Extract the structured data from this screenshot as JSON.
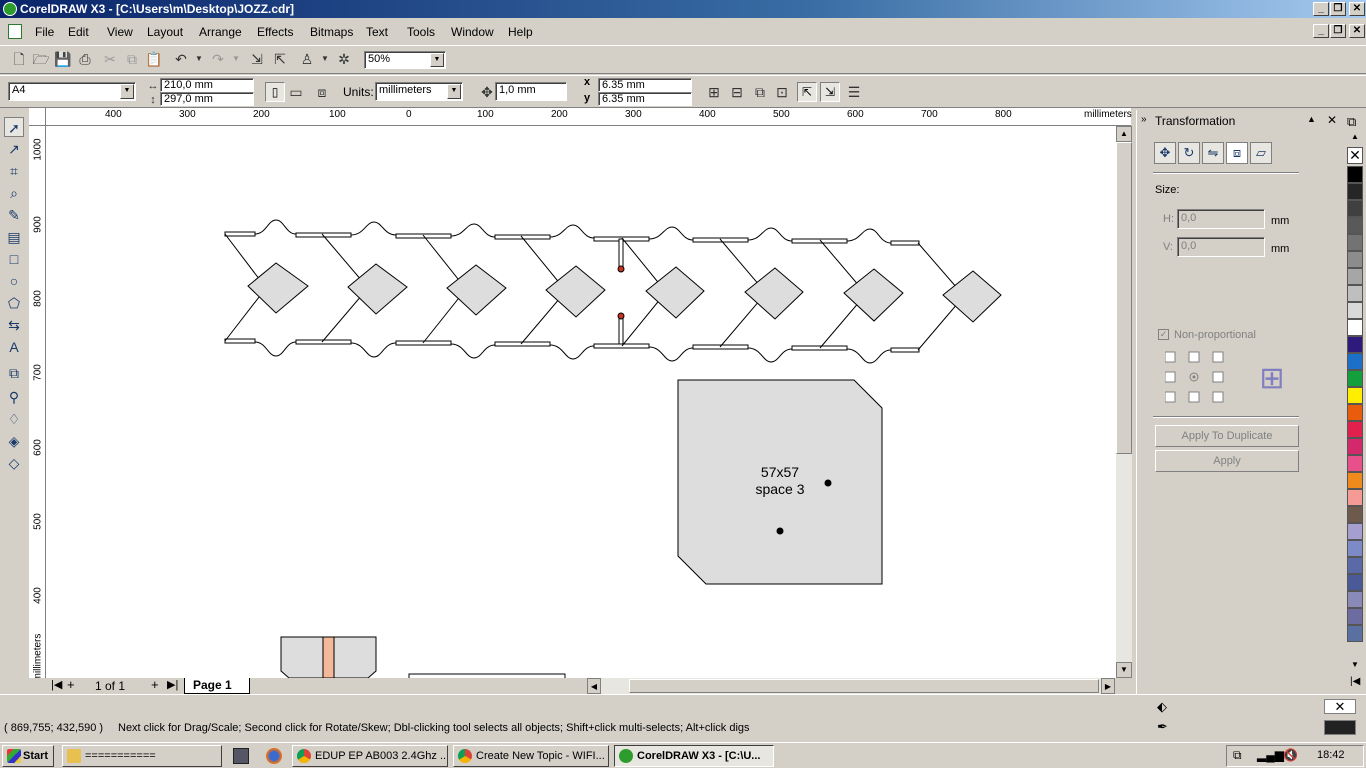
{
  "window": {
    "title": "CorelDRAW X3 - [C:\\Users\\m\\Desktop\\JOZZ.cdr]"
  },
  "menu": [
    "File",
    "Edit",
    "View",
    "Layout",
    "Arrange",
    "Effects",
    "Bitmaps",
    "Text",
    "Tools",
    "Window",
    "Help"
  ],
  "standard_toolbar": {
    "zoom": "50%"
  },
  "property_bar": {
    "paper": "A4",
    "width": "210,0 mm",
    "height": "297,0 mm",
    "units_label": "Units:",
    "units": "millimeters",
    "nudge": "1,0 mm",
    "dup_x": "6.35 mm",
    "dup_y": "6.35 mm",
    "x_label": "x",
    "y_label": "y"
  },
  "ruler": {
    "unit": "millimeters",
    "h_ticks": [
      "400",
      "300",
      "200",
      "100",
      "0",
      "100",
      "200",
      "300",
      "400",
      "500",
      "600",
      "700",
      "800"
    ],
    "v_ticks": [
      "1000",
      "900",
      "800",
      "700",
      "600",
      "500",
      "400"
    ]
  },
  "canvas": {
    "box_text_1": "57x57",
    "box_text_2": "space 3"
  },
  "page_nav": {
    "count": "1 of 1",
    "tab": "Page 1"
  },
  "docker": {
    "title": "Transformation",
    "size_label": "Size:",
    "h_label": "H:",
    "h_value": "0,0",
    "v_label": "V:",
    "v_value": "0,0",
    "unit": "mm",
    "nonprop": "Non-proportional",
    "apply_dup": "Apply To Duplicate",
    "apply": "Apply"
  },
  "status": {
    "coords": "( 869,755; 432,590 )",
    "message": "Next click for Drag/Scale; Second click for Rotate/Skew; Dbl-clicking tool selects all objects; Shift+click multi-selects; Alt+click digs"
  },
  "taskbar": {
    "start": "Start",
    "tasks": [
      "===========",
      "EDUP EP AB003 2.4Ghz ...",
      "Create New Topic - WIFI...",
      "CorelDRAW X3 - [C:\\U..."
    ],
    "clock": "18:42"
  },
  "palette_colors": [
    "#000000",
    "#262626",
    "#404040",
    "#595959",
    "#737373",
    "#8c8c8c",
    "#a6a6a6",
    "#bfbfbf",
    "#d9d9d9",
    "#ffffff",
    "#2e1a7a",
    "#1d70c8",
    "#13a03c",
    "#ffee00",
    "#e85c0c",
    "#e2204e",
    "#d4286c",
    "#e8508c",
    "#f08a1c",
    "#f59a94",
    "#6e5a4a",
    "#a59fd0",
    "#7c8ac8",
    "#5a6aa8",
    "#4a5a98",
    "#8a8ab8",
    "#6c6ca0",
    "#5a70a0"
  ]
}
